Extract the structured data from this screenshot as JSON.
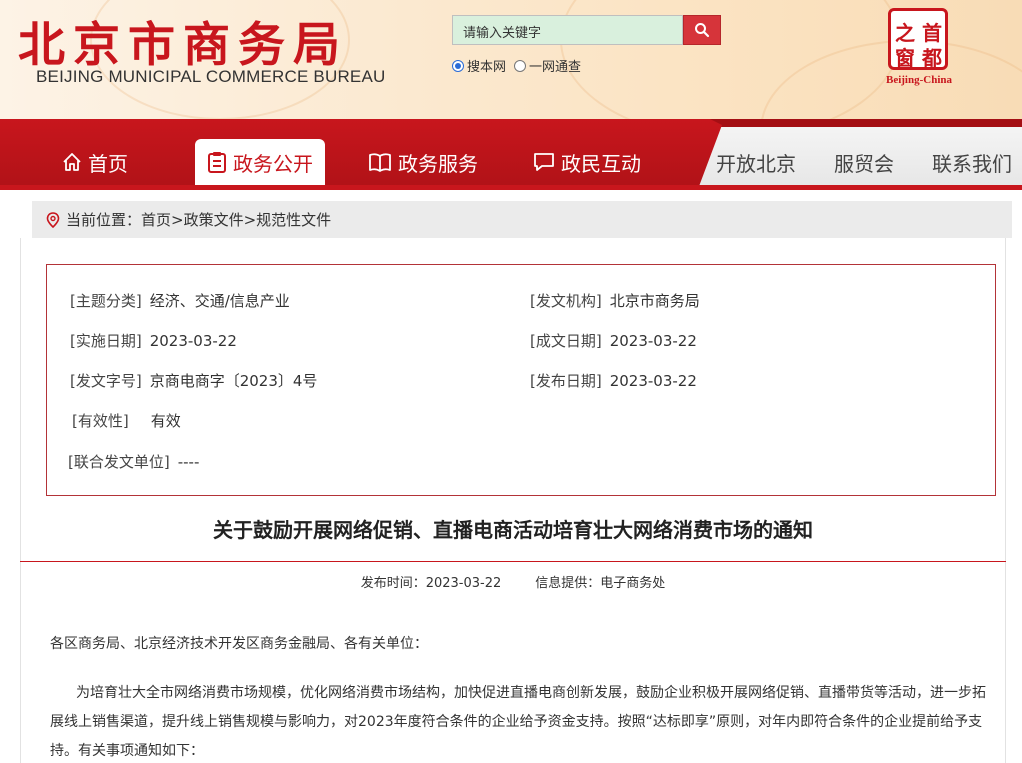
{
  "header": {
    "logo_cn": "北京市商务局",
    "logo_en": "BEIJING MUNICIPAL COMMERCE BUREAU",
    "search": {
      "placeholder": "请输入关键字",
      "button_icon": "search-icon"
    },
    "search_scope": [
      {
        "label": "搜本网",
        "selected": true
      },
      {
        "label": "一网通查",
        "selected": false
      }
    ],
    "capital_logo": {
      "chars": [
        "之",
        "首",
        "窗",
        "都"
      ],
      "text": "Beijing-China"
    }
  },
  "nav": {
    "items": [
      {
        "label": "首页",
        "icon": "home-icon",
        "active": false
      },
      {
        "label": "政务公开",
        "icon": "clipboard-icon",
        "active": true
      },
      {
        "label": "政务服务",
        "icon": "book-icon",
        "active": false
      },
      {
        "label": "政民互动",
        "icon": "chat-icon",
        "active": false
      }
    ],
    "secondary": [
      "开放北京",
      "服贸会",
      "联系我们"
    ]
  },
  "breadcrumb": {
    "icon": "location-pin-icon",
    "prefix": "当前位置：",
    "trail": "首页>政策文件>规范性文件"
  },
  "info": {
    "topic_label": "[主题分类]",
    "topic_value": "经济、交通/信息产业",
    "issuer_label": "[发文机构]",
    "issuer_value": "北京市商务局",
    "effective_label": "[实施日期]",
    "effective_value": "2023-03-22",
    "written_label": "[成文日期]",
    "written_value": "2023-03-22",
    "docno_label": "[发文字号]",
    "docno_value": "京商电商字〔2023〕4号",
    "published_label": "[发布日期]",
    "published_value": "2023-03-22",
    "validity_label": "[有效性]",
    "validity_value": "有效",
    "joint_label": "[联合发文单位]",
    "joint_value": "----"
  },
  "article": {
    "title": "关于鼓励开展网络促销、直播电商活动培育壮大网络消费市场的通知",
    "publish_time": "发布时间：2023-03-22",
    "source": "信息提供：电子商务处",
    "addressee": "各区商务局、北京经济技术开发区商务金融局、各有关单位：",
    "body_line1": "为培育壮大全市网络消费市场规模，优化网络消费市场结构，加快促进直播电商创新发展，鼓励企业积极开展网络促销、直播带货等活动，进一步拓",
    "body_line2": "展线上销售渠道，提升线上销售规模与影响力，对2023年度符合条件的企业给予资金支持。按照“达标即享”原则，对年内即符合条件的企业提前给予支",
    "body_line3": "持。有关事项通知如下："
  },
  "colors": {
    "brand_red": "#c8161d",
    "search_bg": "#d9f0dd",
    "breadcrumb_bg": "#ebebeb"
  }
}
